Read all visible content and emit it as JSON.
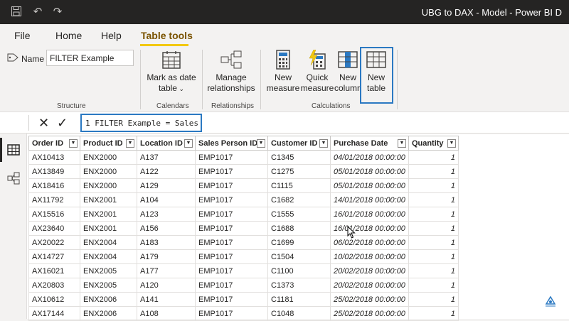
{
  "window": {
    "title": "UBG to DAX - Model - Power BI D"
  },
  "menu": {
    "tabs": [
      {
        "label": "File"
      },
      {
        "label": "Home"
      },
      {
        "label": "Help"
      },
      {
        "label": "Table tools"
      }
    ]
  },
  "ribbon": {
    "structure": {
      "name_label": "Name",
      "name_value": "FILTER Example",
      "group_label": "Structure"
    },
    "calendars": {
      "mark_as_date_line1": "Mark as date",
      "mark_as_date_line2": "table",
      "group_label": "Calendars"
    },
    "relationships": {
      "manage_line1": "Manage",
      "manage_line2": "relationships",
      "group_label": "Relationships"
    },
    "calculations": {
      "new_measure_line1": "New",
      "new_measure_line2": "measure",
      "quick_measure_line1": "Quick",
      "quick_measure_line2": "measure",
      "new_column_line1": "New",
      "new_column_line2": "column",
      "new_table_line1": "New",
      "new_table_line2": "table",
      "group_label": "Calculations"
    }
  },
  "formula_bar": {
    "cancel_glyph": "✕",
    "commit_glyph": "✓",
    "formula": "1  FILTER Example = Sales"
  },
  "table": {
    "columns": [
      "Order ID",
      "Product ID",
      "Location ID",
      "Sales Person ID",
      "Customer ID",
      "Purchase Date",
      "Quantity"
    ],
    "rows": [
      [
        "AX10413",
        "ENX2000",
        "A137",
        "EMP1017",
        "C1345",
        "04/01/2018 00:00:00",
        "1"
      ],
      [
        "AX13849",
        "ENX2000",
        "A122",
        "EMP1017",
        "C1275",
        "05/01/2018 00:00:00",
        "1"
      ],
      [
        "AX18416",
        "ENX2000",
        "A129",
        "EMP1017",
        "C1115",
        "05/01/2018 00:00:00",
        "1"
      ],
      [
        "AX11792",
        "ENX2001",
        "A104",
        "EMP1017",
        "C1682",
        "14/01/2018 00:00:00",
        "1"
      ],
      [
        "AX15516",
        "ENX2001",
        "A123",
        "EMP1017",
        "C1555",
        "16/01/2018 00:00:00",
        "1"
      ],
      [
        "AX23640",
        "ENX2001",
        "A156",
        "EMP1017",
        "C1688",
        "16/01/2018 00:00:00",
        "1"
      ],
      [
        "AX20022",
        "ENX2004",
        "A183",
        "EMP1017",
        "C1699",
        "06/02/2018 00:00:00",
        "1"
      ],
      [
        "AX14727",
        "ENX2004",
        "A179",
        "EMP1017",
        "C1504",
        "10/02/2018 00:00:00",
        "1"
      ],
      [
        "AX16021",
        "ENX2005",
        "A177",
        "EMP1017",
        "C1100",
        "20/02/2018 00:00:00",
        "1"
      ],
      [
        "AX20803",
        "ENX2005",
        "A120",
        "EMP1017",
        "C1373",
        "20/02/2018 00:00:00",
        "1"
      ],
      [
        "AX10612",
        "ENX2006",
        "A141",
        "EMP1017",
        "C1181",
        "25/02/2018 00:00:00",
        "1"
      ],
      [
        "AX17144",
        "ENX2006",
        "A108",
        "EMP1017",
        "C1048",
        "25/02/2018 00:00:00",
        "1"
      ]
    ]
  },
  "colors": {
    "accent_yellow": "#f2c811",
    "highlight_blue": "#2b79c2",
    "titlebar": "#252423"
  }
}
